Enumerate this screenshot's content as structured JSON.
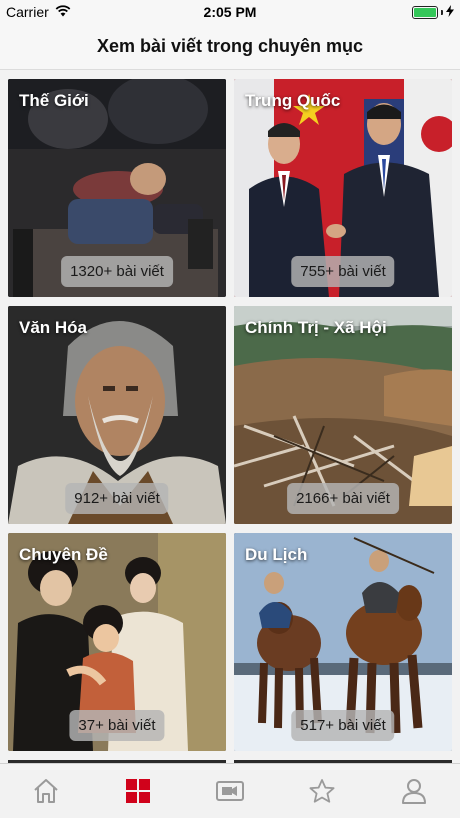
{
  "status_bar": {
    "carrier": "Carrier",
    "time": "2:05 PM",
    "icons": [
      "wifi-icon",
      "battery-icon",
      "charging-bolt-icon"
    ]
  },
  "header": {
    "title": "Xem bài viết trong chuyên mục"
  },
  "categories": [
    {
      "title": "Thế Giới",
      "count": "1320+ bài viết"
    },
    {
      "title": "Trung Quốc",
      "count": "755+ bài viết"
    },
    {
      "title": "Văn Hóa",
      "count": "912+ bài viết"
    },
    {
      "title": "Chính Trị - Xã Hội",
      "count": "2166+ bài viết"
    },
    {
      "title": "Chuyên Đề",
      "count": "37+ bài viết"
    },
    {
      "title": "Du Lịch",
      "count": "517+ bài viết"
    }
  ],
  "tabbar": {
    "tabs": [
      {
        "icon": "home-icon",
        "active": false
      },
      {
        "icon": "grid-icon",
        "active": true
      },
      {
        "icon": "video-icon",
        "active": false
      },
      {
        "icon": "star-icon",
        "active": false
      },
      {
        "icon": "user-icon",
        "active": false
      }
    ],
    "active_color": "#d0021b",
    "inactive_color": "#9a9a9a"
  }
}
